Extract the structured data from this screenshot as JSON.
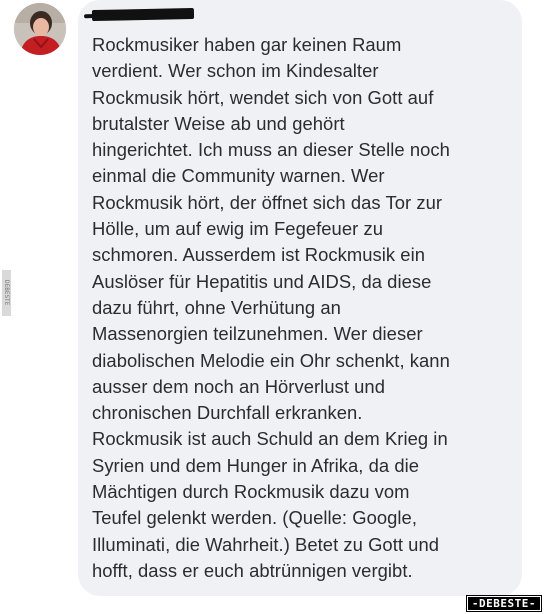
{
  "comment": {
    "author_name": "",
    "text": "Rockmusiker haben gar keinen Raum\nverdient. Wer schon im Kindesalter\nRockmusik hört, wendet sich von Gott auf\nbrutalster Weise ab und gehört\nhingerichtet. Ich muss an dieser Stelle noch\neinmal die Community warnen. Wer\nRockmusik hört, der öffnet sich das Tor zur\nHölle, um auf ewig im Fegefeuer zu\nschmoren. Ausserdem ist Rockmusik ein\nAuslöser für Hepatitis und AIDS, da diese\ndazu führt, ohne Verhütung an\nMassenorgien teilzunehmen. Wer dieser\ndiabolischen Melodie ein Ohr schenkt, kann\nausser dem noch an Hörverlust und\nchronischen Durchfall erkranken.\nRockmusik ist auch Schuld an dem Krieg in\nSyrien und dem Hunger in Afrika, da die\nMächtigen durch Rockmusik dazu vom\nTeufel gelenkt werden. (Quelle: Google,\nIlluminati, die Wahrheit.) Betet zu Gott und\nhofft, dass er euch abtrünnigen vergibt."
  },
  "watermark": {
    "side_text": "DEBESTE",
    "logo_text": "-DEBESTE-"
  },
  "colors": {
    "bubble_background": "#f0f1f4",
    "text": "#2b2c30",
    "redaction": "#111111"
  },
  "icons": {
    "avatar": "profile-photo"
  }
}
